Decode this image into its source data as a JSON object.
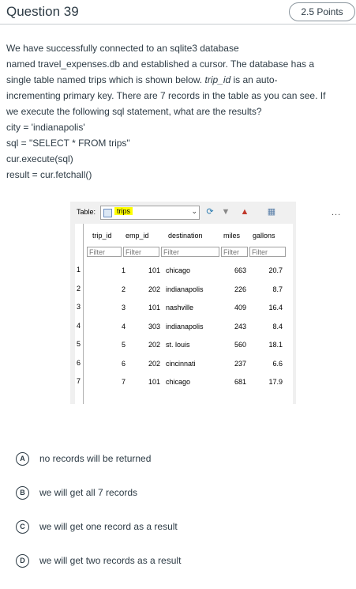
{
  "question": {
    "title": "Question 39",
    "points": "2.5 Points",
    "body_lines": [
      "We have successfully connected to an sqlite3 database",
      "named travel_expenses.db  and established a cursor. The database has a",
      "single table named  trips which is shown below.",
      "incrementing primary key. There are 7 records in the table as you can see. If",
      "we execute the following sql statement, what are the results?",
      "city = 'indianapolis'",
      "sql = \"SELECT * FROM trips\"",
      "cur.execute(sql)",
      "result = cur.fetchall()"
    ],
    "italic_segment": "trip_id",
    "line3_tail": " is an auto-"
  },
  "db_browser": {
    "table_label": "Table:",
    "table_name": "trips",
    "more": "...",
    "columns": [
      "trip_id",
      "emp_id",
      "destination",
      "miles",
      "gallons"
    ],
    "filter_placeholder": "Filter",
    "row_numbers": [
      "1",
      "2",
      "3",
      "4",
      "5",
      "6",
      "7"
    ],
    "rows": [
      [
        "1",
        "101",
        "chicago",
        "663",
        "20.7"
      ],
      [
        "2",
        "202",
        "indianapolis",
        "226",
        "8.7"
      ],
      [
        "3",
        "101",
        "nashville",
        "409",
        "16.4"
      ],
      [
        "4",
        "303",
        "indianapolis",
        "243",
        "8.4"
      ],
      [
        "5",
        "202",
        "st. louis",
        "560",
        "18.1"
      ],
      [
        "6",
        "202",
        "cincinnati",
        "237",
        "6.6"
      ],
      [
        "7",
        "101",
        "chicago",
        "681",
        "17.9"
      ]
    ]
  },
  "answers": [
    {
      "letter": "A",
      "text": "no records will be returned"
    },
    {
      "letter": "B",
      "text": "we will get all 7 records"
    },
    {
      "letter": "C",
      "text": "we will get one record as a result"
    },
    {
      "letter": "D",
      "text": "we will get two records as a result"
    }
  ]
}
